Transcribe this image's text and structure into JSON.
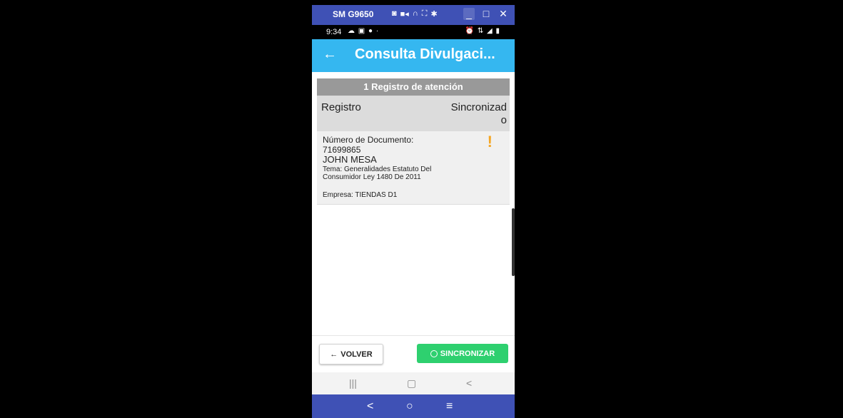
{
  "window": {
    "device_name": "SM G9650",
    "toolbar_icons": [
      "camera-icon",
      "record-icon",
      "headset-icon",
      "fullscreen-icon",
      "settings-icon"
    ],
    "window_controls": [
      "minimize-icon",
      "maximize-icon",
      "close-icon"
    ]
  },
  "status_bar": {
    "time": "9:34",
    "left_icons": "☁ ▣ ● ·",
    "right_icons": "⏰ ⇅ ◢ ▮"
  },
  "app_bar": {
    "back_icon": "←",
    "title": "Consulta Divulgaci..."
  },
  "list": {
    "header": "1 Registro de atención",
    "columns": [
      "Registro",
      "Sincronizado"
    ],
    "records": [
      {
        "doc_label": "Número de Documento:",
        "doc_number": "71699865",
        "name": "JOHN MESA",
        "tema": "Tema: Generalidades Estatuto Del Consumidor Ley 1480 De 2011",
        "empresa": "Empresa: TIENDAS D1",
        "status_icon": "!",
        "status_color": "#f5a623"
      }
    ]
  },
  "buttons": {
    "volver": "VOLVER",
    "volver_icon": "←",
    "sincronizar": "SINCRONIZAR"
  },
  "device_nav": {
    "recents": "|||",
    "home": "▢",
    "back": "<"
  },
  "scrcpy_nav": {
    "back": "<",
    "home": "○",
    "menu": "≡"
  },
  "colors": {
    "title_bar": "#3f51b5",
    "app_bar": "#35b7f0",
    "sync_button": "#2ed06f",
    "header_gray": "#999999"
  }
}
